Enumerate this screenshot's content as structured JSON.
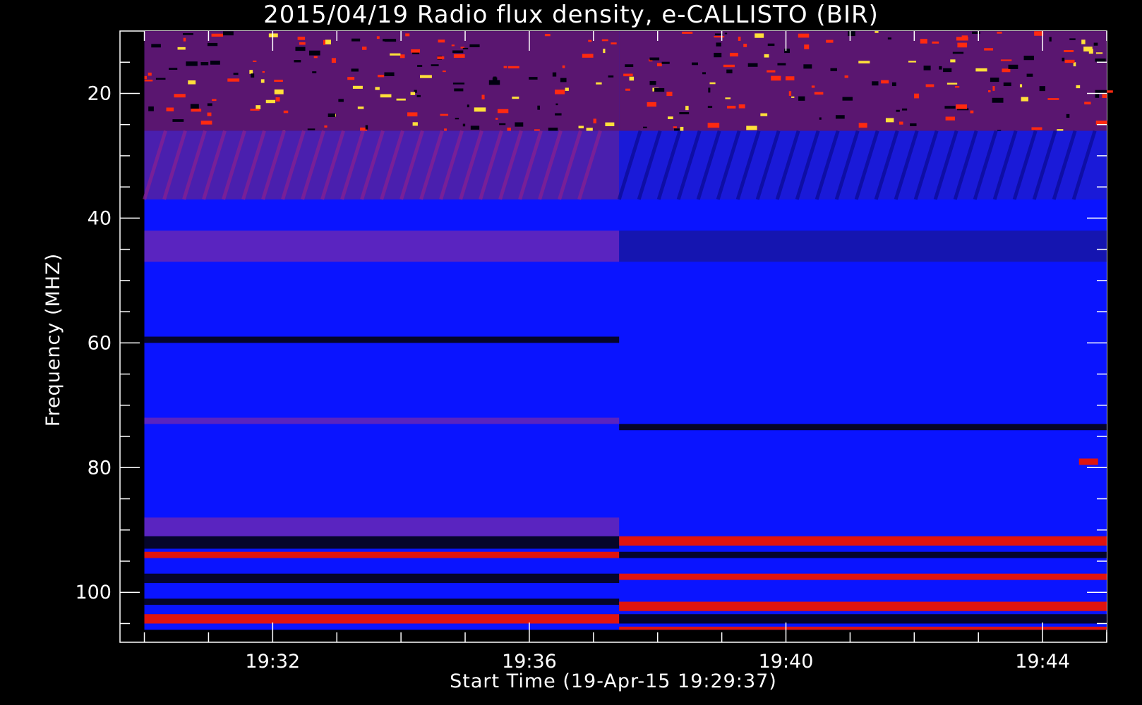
{
  "chart_data": {
    "type": "heatmap",
    "title": "2015/04/19  Radio flux density, e-CALLISTO (BIR)",
    "xlabel": "Start Time (19-Apr-15 19:29:37)",
    "ylabel": "Frequency (MHZ)",
    "x_ticks": [
      "19:32",
      "19:36",
      "19:40",
      "19:44"
    ],
    "x_tick_minutes": [
      32,
      36,
      40,
      44
    ],
    "y_ticks": [
      "20",
      "40",
      "60",
      "80",
      "100"
    ],
    "y_tick_values": [
      20,
      40,
      60,
      80,
      100
    ],
    "xlim_minutes": [
      29.62,
      45.0
    ],
    "data_x_range_minutes": [
      30.0,
      45.0
    ],
    "ylim": [
      10,
      108
    ],
    "y_inverted": true,
    "data_y_range": [
      10,
      106
    ],
    "instrument_change_minute": 37.4,
    "colormap": [
      "#000000",
      "#0000ff",
      "#ff0000",
      "#ffff00"
    ],
    "background_color": "#0a14ff",
    "bands": [
      {
        "segment": "before",
        "y_from": 10,
        "y_to": 26,
        "level": "bursty-red-yellow"
      },
      {
        "segment": "after",
        "y_from": 10,
        "y_to": 26,
        "level": "bursty-red-yellow"
      },
      {
        "segment": "before",
        "y_from": 26,
        "y_to": 37,
        "level": "diagonal-striations-red"
      },
      {
        "segment": "after",
        "y_from": 26,
        "y_to": 37,
        "level": "diagonal-striations-dark"
      },
      {
        "segment": "before",
        "y_from": 42,
        "y_to": 47,
        "level": "purple"
      },
      {
        "segment": "after",
        "y_from": 42,
        "y_to": 47,
        "level": "dark-blue"
      },
      {
        "segment": "before",
        "y_from": 59,
        "y_to": 60,
        "level": "dark"
      },
      {
        "segment": "before",
        "y_from": 72,
        "y_to": 73,
        "level": "purple"
      },
      {
        "segment": "after",
        "y_from": 73,
        "y_to": 74,
        "level": "dark"
      },
      {
        "segment": "before",
        "y_from": 88,
        "y_to": 91,
        "level": "purple"
      },
      {
        "segment": "before",
        "y_from": 91,
        "y_to": 93,
        "level": "dark"
      },
      {
        "segment": "before",
        "y_from": 93.5,
        "y_to": 94.5,
        "level": "red"
      },
      {
        "segment": "before",
        "y_from": 97,
        "y_to": 98.5,
        "level": "dark"
      },
      {
        "segment": "before",
        "y_from": 101,
        "y_to": 102,
        "level": "dark"
      },
      {
        "segment": "before",
        "y_from": 103.5,
        "y_to": 105,
        "level": "red"
      },
      {
        "segment": "after",
        "y_from": 91,
        "y_to": 92.5,
        "level": "red"
      },
      {
        "segment": "after",
        "y_from": 93.5,
        "y_to": 94.5,
        "level": "dark"
      },
      {
        "segment": "after",
        "y_from": 97,
        "y_to": 98,
        "level": "red"
      },
      {
        "segment": "after",
        "y_from": 101.5,
        "y_to": 103,
        "level": "red"
      },
      {
        "segment": "after",
        "y_from": 103.5,
        "y_to": 105,
        "level": "dark"
      },
      {
        "segment": "after",
        "y_from": 105.5,
        "y_to": 106,
        "level": "red"
      }
    ],
    "spot": {
      "x_minute": 44.7,
      "y": 79,
      "level": "red"
    }
  }
}
